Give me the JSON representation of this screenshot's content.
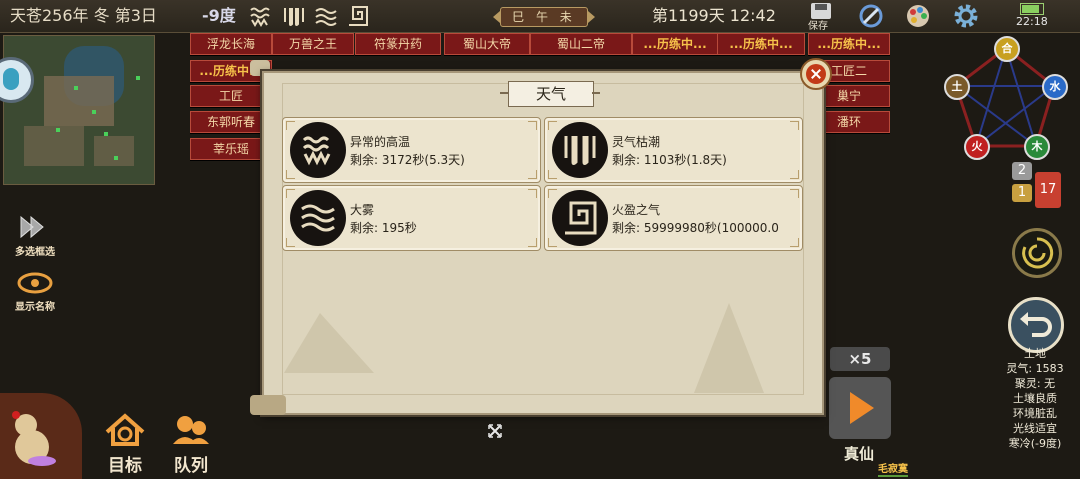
{
  "topbar": {
    "date": "天苍256年 冬 第3日",
    "temperature": "-9度",
    "weather_icons": [
      "heat-wave-icon",
      "spirit-ebb-icon",
      "fog-icon",
      "fire-qi-icon"
    ],
    "era": "巳 午 未",
    "day_time": "第1199天 12:42",
    "save_label": "保存",
    "clock": "22:18",
    "icons": [
      "save-icon",
      "compass-icon",
      "palette-icon",
      "gear-icon"
    ]
  },
  "npc_tags": [
    {
      "label": "浮龙长海",
      "busy": false
    },
    {
      "label": "万兽之王",
      "busy": false
    },
    {
      "label": "符篆丹药",
      "busy": false
    },
    {
      "label": "蜀山大帝",
      "busy": false
    },
    {
      "label": "蜀山二帝",
      "busy": false
    },
    {
      "label": "...历练中...",
      "busy": true
    },
    {
      "label": "...历练中...",
      "busy": true
    },
    {
      "label": "...历练中...",
      "busy": true
    },
    {
      "label": "...历练中...",
      "busy": true
    },
    {
      "label": "工匠二",
      "busy": false
    },
    {
      "label": "工匠",
      "busy": false
    },
    {
      "label": "巢宁",
      "busy": false
    },
    {
      "label": "东郭听春",
      "busy": false
    },
    {
      "label": "潘环",
      "busy": false
    },
    {
      "label": "莘乐瑶",
      "busy": false
    }
  ],
  "left_buttons": {
    "multi_select": "多选框选",
    "show_names": "显示名称"
  },
  "bottom_buttons": {
    "target": "目标",
    "team": "队列"
  },
  "elements": {
    "top": "合",
    "left": "土",
    "right": "水",
    "bottom_left": "火",
    "bottom_right": "木"
  },
  "badges": {
    "gray": "2",
    "gold": "1",
    "red": "17"
  },
  "info_panel": {
    "lines": [
      "土地",
      "灵气: 1583",
      "聚灵: 无",
      "土壤良质",
      "环境脏乱",
      "光线适宜",
      "寒冷(-9度)"
    ]
  },
  "speed": "×5",
  "sim_label": "真仙",
  "target_name": "毛寂寞",
  "dialog": {
    "title": "天气",
    "remaining_prefix": "剩余:",
    "weathers": [
      {
        "name": "异常的高温",
        "remaining": "剩余: 3172秒(5.3天)",
        "icon": "heat-wave-icon"
      },
      {
        "name": "灵气枯潮",
        "remaining": "剩余: 1103秒(1.8天)",
        "icon": "spirit-ebb-icon"
      },
      {
        "name": "大雾",
        "remaining": "剩余: 195秒",
        "icon": "fog-icon"
      },
      {
        "name": "火盈之气",
        "remaining": "剩余: 59999980秒(100000.0",
        "icon": "fire-qi-icon"
      }
    ]
  },
  "colors": {
    "tag_bg": "#7a1818",
    "busy_text": "#f6c24a",
    "dialog_bg": "#ddd5bd",
    "card_bg": "#ece4ce",
    "play_arrow": "#f08a2a"
  }
}
